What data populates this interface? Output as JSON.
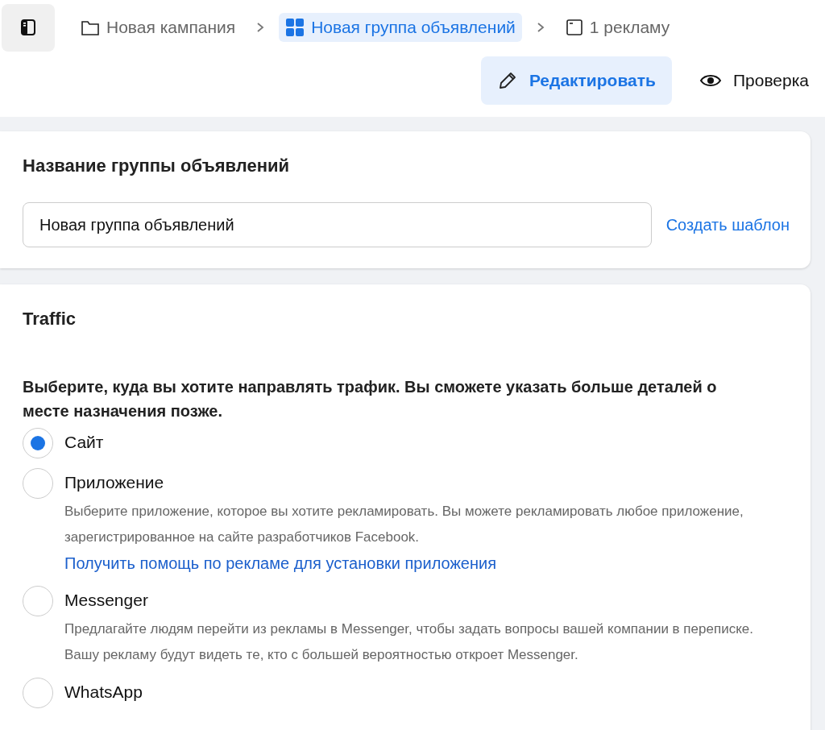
{
  "breadcrumbs": [
    {
      "kind": "campaign",
      "label": "Новая кампания",
      "selected": false
    },
    {
      "kind": "adset",
      "label": "Новая группа объявлений",
      "selected": true
    },
    {
      "kind": "ad",
      "label": "1 рекламу",
      "selected": false
    }
  ],
  "modes": [
    {
      "kind": "edit",
      "label": "Редактировать",
      "selected": true
    },
    {
      "kind": "review",
      "label": "Проверка",
      "selected": false
    }
  ],
  "name_card": {
    "title": "Название группы объявлений",
    "value": "Новая группа объявлений",
    "template_link": "Создать шаблон"
  },
  "traffic_card": {
    "title": "Traffic",
    "question": "Выберите, куда вы хотите направлять трафик. Вы сможете указать больше деталей о месте назначения позже.",
    "options": [
      {
        "label": "Сайт",
        "selected": true
      },
      {
        "label": "Приложение",
        "selected": false,
        "description": "Выберите приложение, которое вы хотите рекламировать. Вы можете рекламировать любое приложение, зарегистрированное на сайте разработчиков Facebook.",
        "link": "Получить помощь по рекламе для установки приложения"
      },
      {
        "label": "Messenger",
        "selected": false,
        "description": "Предлагайте людям перейти из рекламы в Messenger, чтобы задать вопросы вашей компании в переписке. Вашу рекламу будут видеть те, кто с большей вероятностью откроет Messenger."
      },
      {
        "label": "WhatsApp",
        "selected": false
      }
    ]
  }
}
